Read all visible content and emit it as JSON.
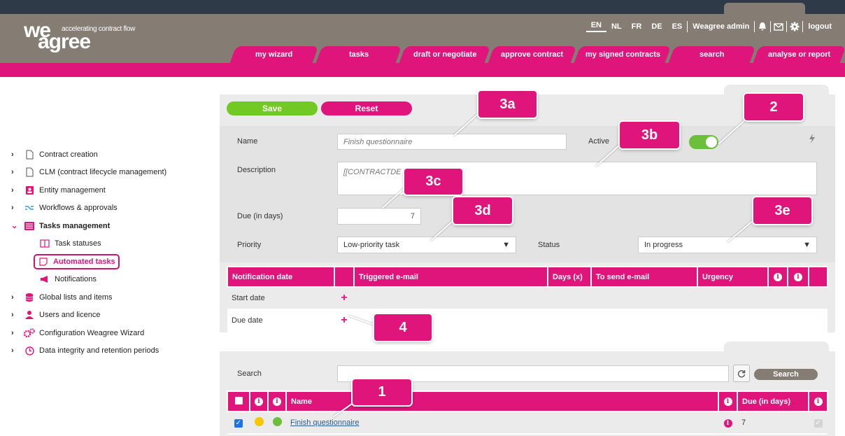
{
  "brand": {
    "line1": "we",
    "line2": "agree",
    "tagline": "accelerating contract flow",
    "accent": "#e0157b",
    "header_bg": "#857c74"
  },
  "langs": [
    "EN",
    "NL",
    "FR",
    "DE",
    "ES"
  ],
  "active_lang": "EN",
  "user": {
    "name": "Weagree admin",
    "logout": "logout"
  },
  "nav": [
    "my wizard",
    "tasks",
    "draft or negotiate",
    "approve contract",
    "my signed contracts",
    "search",
    "analyse or report"
  ],
  "sidebar": {
    "items": [
      {
        "label": "Contract creation",
        "icon": "document-icon"
      },
      {
        "label": "CLM (contract lifecycle management)",
        "icon": "document-icon"
      },
      {
        "label": "Entity management",
        "icon": "entity-icon"
      },
      {
        "label": "Workflows & approvals",
        "icon": "workflow-icon"
      },
      {
        "label": "Tasks management",
        "icon": "tasks-icon"
      },
      {
        "label": "Global lists and items",
        "icon": "database-icon"
      },
      {
        "label": "Users and licence",
        "icon": "user-icon"
      },
      {
        "label": "Configuration Weagree Wizard",
        "icon": "gears-icon"
      },
      {
        "label": "Data integrity and retention periods",
        "icon": "clock-icon"
      }
    ],
    "sub": [
      {
        "label": "Task statuses",
        "icon": "book-icon"
      },
      {
        "label": "Automated tasks",
        "icon": "note-icon"
      },
      {
        "label": "Notifications",
        "icon": "megaphone-icon"
      }
    ]
  },
  "buttons": {
    "save": "Save",
    "reset": "Reset",
    "search": "Search"
  },
  "form": {
    "name_label": "Name",
    "name_value": "Finish questionnaire",
    "active_label": "Active",
    "desc_label": "Description",
    "desc_value": "[[CONTRACTDE",
    "due_label": "Due (in days)",
    "due_value": "7",
    "priority_label": "Priority",
    "priority_value": "Low-priority task",
    "status_label": "Status",
    "status_value": "In progress"
  },
  "notif_table": {
    "headers": [
      "Notification date",
      "",
      "Triggered e-mail",
      "Days (x)",
      "To send e-mail",
      "Urgency"
    ],
    "rows": [
      "Start date",
      "Due date"
    ]
  },
  "list": {
    "search_label": "Search",
    "headers": {
      "name": "Name",
      "due": "Due (in days)"
    },
    "row": {
      "name": "Finish questionnaire",
      "due": "7"
    }
  },
  "callouts": {
    "c1": "1",
    "c2": "2",
    "c3a": "3a",
    "c3b": "3b",
    "c3c": "3c",
    "c3d": "3d",
    "c3e": "3e",
    "c4": "4"
  }
}
